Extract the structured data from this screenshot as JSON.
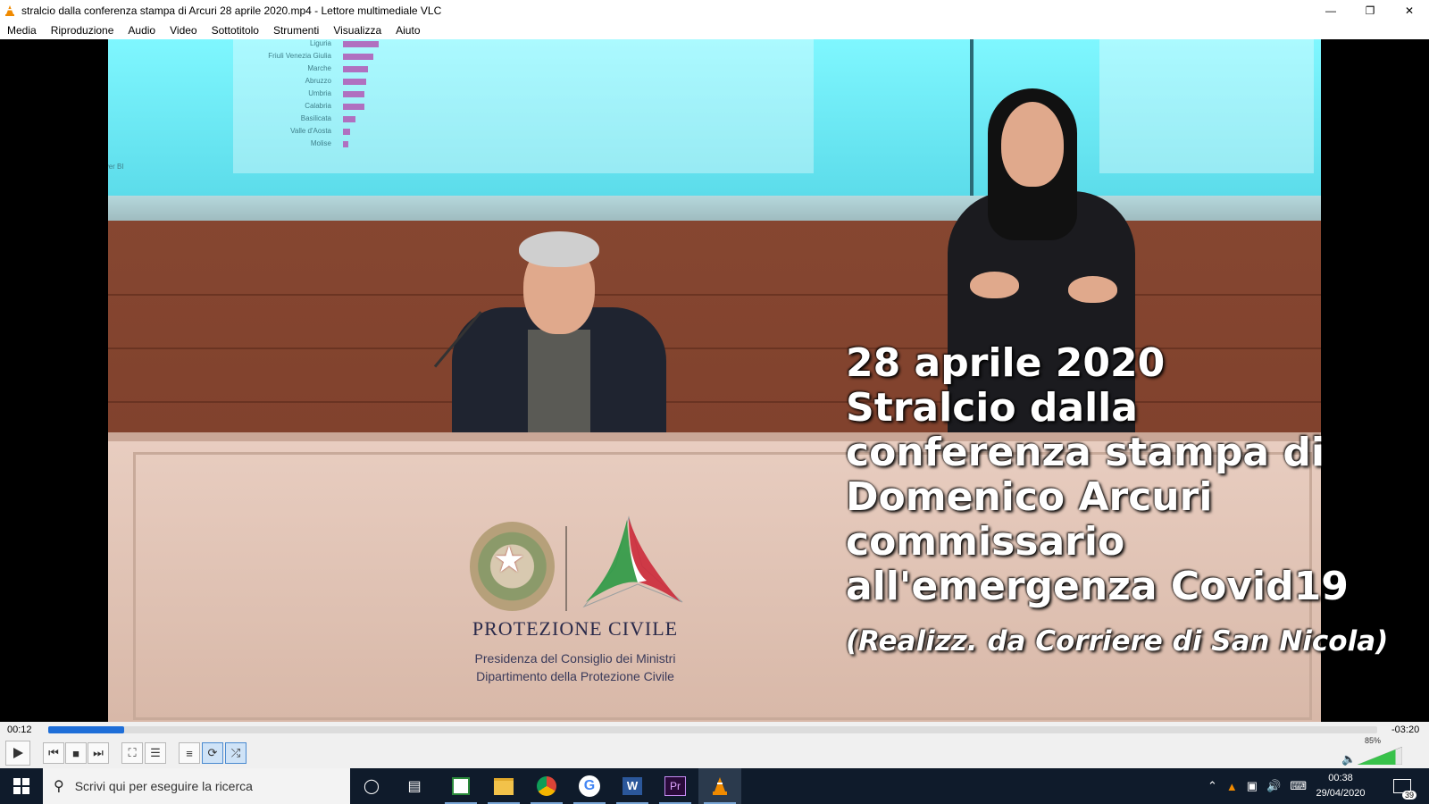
{
  "window": {
    "title": "stralcio dalla conferenza stampa di Arcuri 28 aprile 2020.mp4 - Lettore multimediale VLC",
    "controls": [
      "minimize-icon",
      "restore-icon",
      "close-icon"
    ]
  },
  "menu": [
    "Media",
    "Riproduzione",
    "Audio",
    "Video",
    "Sottotitolo",
    "Strumenti",
    "Visualizza",
    "Aiuto"
  ],
  "video": {
    "overlay_lines": [
      "28 aprile 2020",
      "Stralcio dalla",
      "conferenza stampa di",
      "Domenico Arcuri",
      "commissario",
      "all'emergenza Covid19"
    ],
    "credit": "(Realizz. da Corriere di San Nicola)",
    "desk_logo": {
      "name": "PROTEZIONE CIVILE",
      "line1": "Presidenza del Consiglio dei Ministri",
      "line2": "Dipartimento della Protezione Civile"
    },
    "slide_labels": [
      "Liguria",
      "Friuli Venezia Giulia",
      "Marche",
      "Abruzzo",
      "Umbria",
      "Calabria",
      "Basilicata",
      "Valle d'Aosta",
      "Molise"
    ],
    "slide_footer": "soft Power BI"
  },
  "player": {
    "elapsed": "00:12",
    "remaining": "-03:20",
    "progress": 0.057,
    "volume_percent": "85%",
    "volume": 0.85,
    "buttons": [
      "play",
      "previous",
      "stop",
      "next",
      "fullscreen",
      "extended-settings",
      "playlist",
      "loop",
      "shuffle"
    ]
  },
  "taskbar": {
    "search_placeholder": "Scrivi qui per eseguire la ricerca",
    "apps": [
      "cortana",
      "task-view",
      "ms-project",
      "file-explorer",
      "chrome",
      "google",
      "word",
      "premiere",
      "vlc"
    ],
    "clock_time": "00:38",
    "clock_date": "29/04/2020",
    "notifications": "39"
  }
}
